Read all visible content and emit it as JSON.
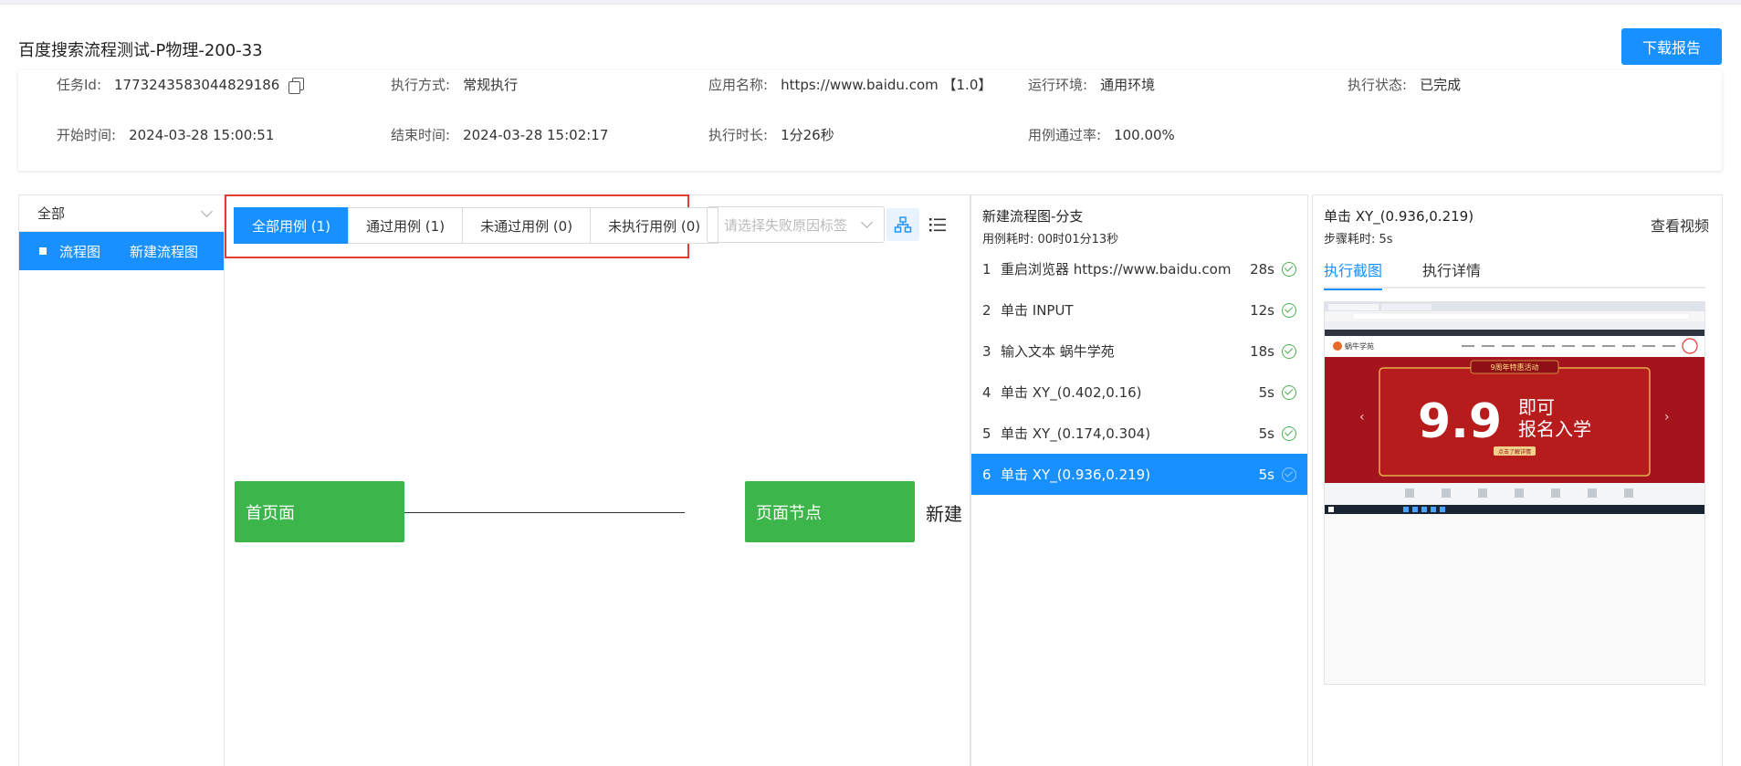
{
  "page_title": "百度搜索流程测试-P物理-200-33",
  "download_label": "下载报告",
  "info": {
    "task_id": {
      "label": "任务Id:",
      "value": "1773243583044829186"
    },
    "exec_mode": {
      "label": "执行方式:",
      "value": "常规执行"
    },
    "app_name": {
      "label": "应用名称:",
      "value": "https://www.baidu.com 【1.0】"
    },
    "env": {
      "label": "运行环境:",
      "value": "通用环境"
    },
    "status": {
      "label": "执行状态:",
      "value": "已完成"
    },
    "start": {
      "label": "开始时间:",
      "value": "2024-03-28 15:00:51"
    },
    "end": {
      "label": "结束时间:",
      "value": "2024-03-28 15:02:17"
    },
    "duration": {
      "label": "执行时长:",
      "value": "1分26秒"
    },
    "pass_rate": {
      "label": "用例通过率:",
      "value": "100.00%"
    }
  },
  "sidebar": {
    "select_value": "全部",
    "item": {
      "type": "流程图",
      "name": "新建流程图"
    }
  },
  "case_tabs": [
    "全部用例 (1)",
    "通过用例 (1)",
    "未通过用例 (0)",
    "未执行用例 (0)"
  ],
  "reason_placeholder": "请选择失败原因标签",
  "flow": {
    "node1": "首页面",
    "node2": "页面节点",
    "extra": "新建"
  },
  "steps_panel": {
    "title": "新建流程图-分支",
    "subtitle": "用例耗时: 00时01分13秒",
    "steps": [
      {
        "num": "1",
        "name": "重启浏览器 https://www.baidu.com",
        "dur": "28s"
      },
      {
        "num": "2",
        "name": "单击 INPUT",
        "dur": "12s"
      },
      {
        "num": "3",
        "name": "输入文本 蜗牛学苑",
        "dur": "18s"
      },
      {
        "num": "4",
        "name": "单击 XY_(0.402,0.16)",
        "dur": "5s"
      },
      {
        "num": "5",
        "name": "单击 XY_(0.174,0.304)",
        "dur": "5s"
      },
      {
        "num": "6",
        "name": "单击 XY_(0.936,0.219)",
        "dur": "5s"
      }
    ]
  },
  "detail": {
    "title": "单击 XY_(0.936,0.219)",
    "subtitle": "步骤耗时: 5s",
    "video_label": "查看视频",
    "tabs": [
      "执行截图",
      "执行详情"
    ],
    "screenshot": {
      "logo": "蜗牛学苑",
      "banner_top": "9周年特惠活动",
      "banner_big": "9.9",
      "banner_side1": "即可",
      "banner_side2": "报名入学",
      "banner_btn": "点击了解详情"
    }
  },
  "colors": {
    "primary": "#1890ff",
    "node": "#3cb54a",
    "highlight": "#e53935",
    "success": "#4caf50"
  }
}
